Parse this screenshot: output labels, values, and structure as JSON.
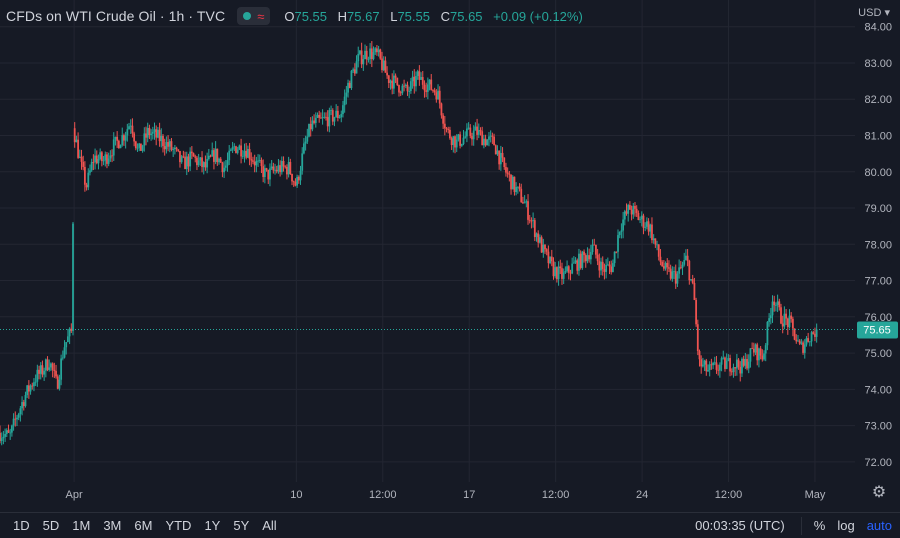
{
  "legend": {
    "title": "CFDs on WTI Crude Oil · 1h · TVC",
    "status_icon": "market-open-dot-icon",
    "delay_icon": "wave-icon",
    "open_label": "O",
    "open_value": "75.55",
    "high_label": "H",
    "high_value": "75.67",
    "low_label": "L",
    "low_value": "75.55",
    "close_label": "C",
    "close_value": "75.65",
    "change": "+0.09 (+0.12%)"
  },
  "currency": "USD",
  "currency_icon": "chevron-down-icon",
  "colors": {
    "background": "#161a25",
    "grid": "#232632",
    "up": "#26a69a",
    "down": "#ef5350",
    "price_line": "#26a69a",
    "text": "#b2b5be",
    "accent": "#2962ff"
  },
  "chart_data": {
    "type": "candlestick",
    "x_ticks": [
      {
        "label": "Apr",
        "x": 0
      },
      {
        "label": "10",
        "x": 9
      },
      {
        "label": "12:00",
        "x": 12.5
      },
      {
        "label": "17",
        "x": 16
      },
      {
        "label": "12:00",
        "x": 19.5
      },
      {
        "label": "24",
        "x": 23
      },
      {
        "label": "12:00",
        "x": 26.5
      },
      {
        "label": "May",
        "x": 30
      }
    ],
    "x_range": [
      -3,
      31.5
    ],
    "y_range": [
      71.5,
      84.35
    ],
    "y_ticks": [
      "72.00",
      "73.00",
      "74.00",
      "75.00",
      "76.00",
      "77.00",
      "78.00",
      "79.00",
      "80.00",
      "81.00",
      "82.00",
      "83.00",
      "84.00"
    ],
    "last_price": "75.65",
    "grid": true,
    "anchors": [
      [
        -3.0,
        72.8
      ],
      [
        -2.6,
        72.7
      ],
      [
        -2.3,
        73.3
      ],
      [
        -2.0,
        73.8
      ],
      [
        -1.6,
        74.3
      ],
      [
        -1.3,
        74.5
      ],
      [
        -1.0,
        74.8
      ],
      [
        -0.7,
        74.1
      ],
      [
        -0.4,
        75.2
      ],
      [
        -0.1,
        75.6
      ],
      [
        0.0,
        81.1
      ],
      [
        0.3,
        80.1
      ],
      [
        0.5,
        79.6
      ],
      [
        0.8,
        80.4
      ],
      [
        1.2,
        80.3
      ],
      [
        1.6,
        80.7
      ],
      [
        2.0,
        81.0
      ],
      [
        2.3,
        81.4
      ],
      [
        2.6,
        80.5
      ],
      [
        3.0,
        81.1
      ],
      [
        3.5,
        80.9
      ],
      [
        4.0,
        80.6
      ],
      [
        4.4,
        80.2
      ],
      [
        4.8,
        80.4
      ],
      [
        5.3,
        80.1
      ],
      [
        5.7,
        80.5
      ],
      [
        6.1,
        80.1
      ],
      [
        6.5,
        80.7
      ],
      [
        7.0,
        80.6
      ],
      [
        7.4,
        80.2
      ],
      [
        7.8,
        79.9
      ],
      [
        8.3,
        80.1
      ],
      [
        8.7,
        80.1
      ],
      [
        9.0,
        79.6
      ],
      [
        9.3,
        80.6
      ],
      [
        9.6,
        81.3
      ],
      [
        10.0,
        81.4
      ],
      [
        10.4,
        81.5
      ],
      [
        10.8,
        81.6
      ],
      [
        11.1,
        82.4
      ],
      [
        11.5,
        83.1
      ],
      [
        11.9,
        83.3
      ],
      [
        12.3,
        83.2
      ],
      [
        12.7,
        82.6
      ],
      [
        13.1,
        82.4
      ],
      [
        13.5,
        82.2
      ],
      [
        13.9,
        82.6
      ],
      [
        14.3,
        82.4
      ],
      [
        14.7,
        82.2
      ],
      [
        15.1,
        81.1
      ],
      [
        15.5,
        80.8
      ],
      [
        15.9,
        81.0
      ],
      [
        16.3,
        81.1
      ],
      [
        16.6,
        80.9
      ],
      [
        17.0,
        80.8
      ],
      [
        17.4,
        80.1
      ],
      [
        17.8,
        79.6
      ],
      [
        18.2,
        79.2
      ],
      [
        18.6,
        78.5
      ],
      [
        19.0,
        77.8
      ],
      [
        19.4,
        77.3
      ],
      [
        19.8,
        77.1
      ],
      [
        20.2,
        77.4
      ],
      [
        20.6,
        77.6
      ],
      [
        21.0,
        77.9
      ],
      [
        21.4,
        77.3
      ],
      [
        21.8,
        77.4
      ],
      [
        22.1,
        78.5
      ],
      [
        22.5,
        79.0
      ],
      [
        22.9,
        78.7
      ],
      [
        23.3,
        78.5
      ],
      [
        23.7,
        77.6
      ],
      [
        24.0,
        77.2
      ],
      [
        24.4,
        77.1
      ],
      [
        24.8,
        77.6
      ],
      [
        25.1,
        76.6
      ],
      [
        25.3,
        74.7
      ],
      [
        25.7,
        74.5
      ],
      [
        26.0,
        74.6
      ],
      [
        26.4,
        74.7
      ],
      [
        26.8,
        74.7
      ],
      [
        27.1,
        74.6
      ],
      [
        27.5,
        75.1
      ],
      [
        27.9,
        74.9
      ],
      [
        28.3,
        76.6
      ],
      [
        28.6,
        76.0
      ],
      [
        29.0,
        75.8
      ],
      [
        29.4,
        75.1
      ],
      [
        29.8,
        75.5
      ],
      [
        30.1,
        75.65
      ]
    ]
  },
  "time_ranges": [
    "1D",
    "5D",
    "1M",
    "3M",
    "6M",
    "YTD",
    "1Y",
    "5Y",
    "All"
  ],
  "clock": "00:03:35 (UTC)",
  "options": {
    "percent": "%",
    "log": "log",
    "auto": "auto"
  },
  "settings_icon": "gear-icon"
}
